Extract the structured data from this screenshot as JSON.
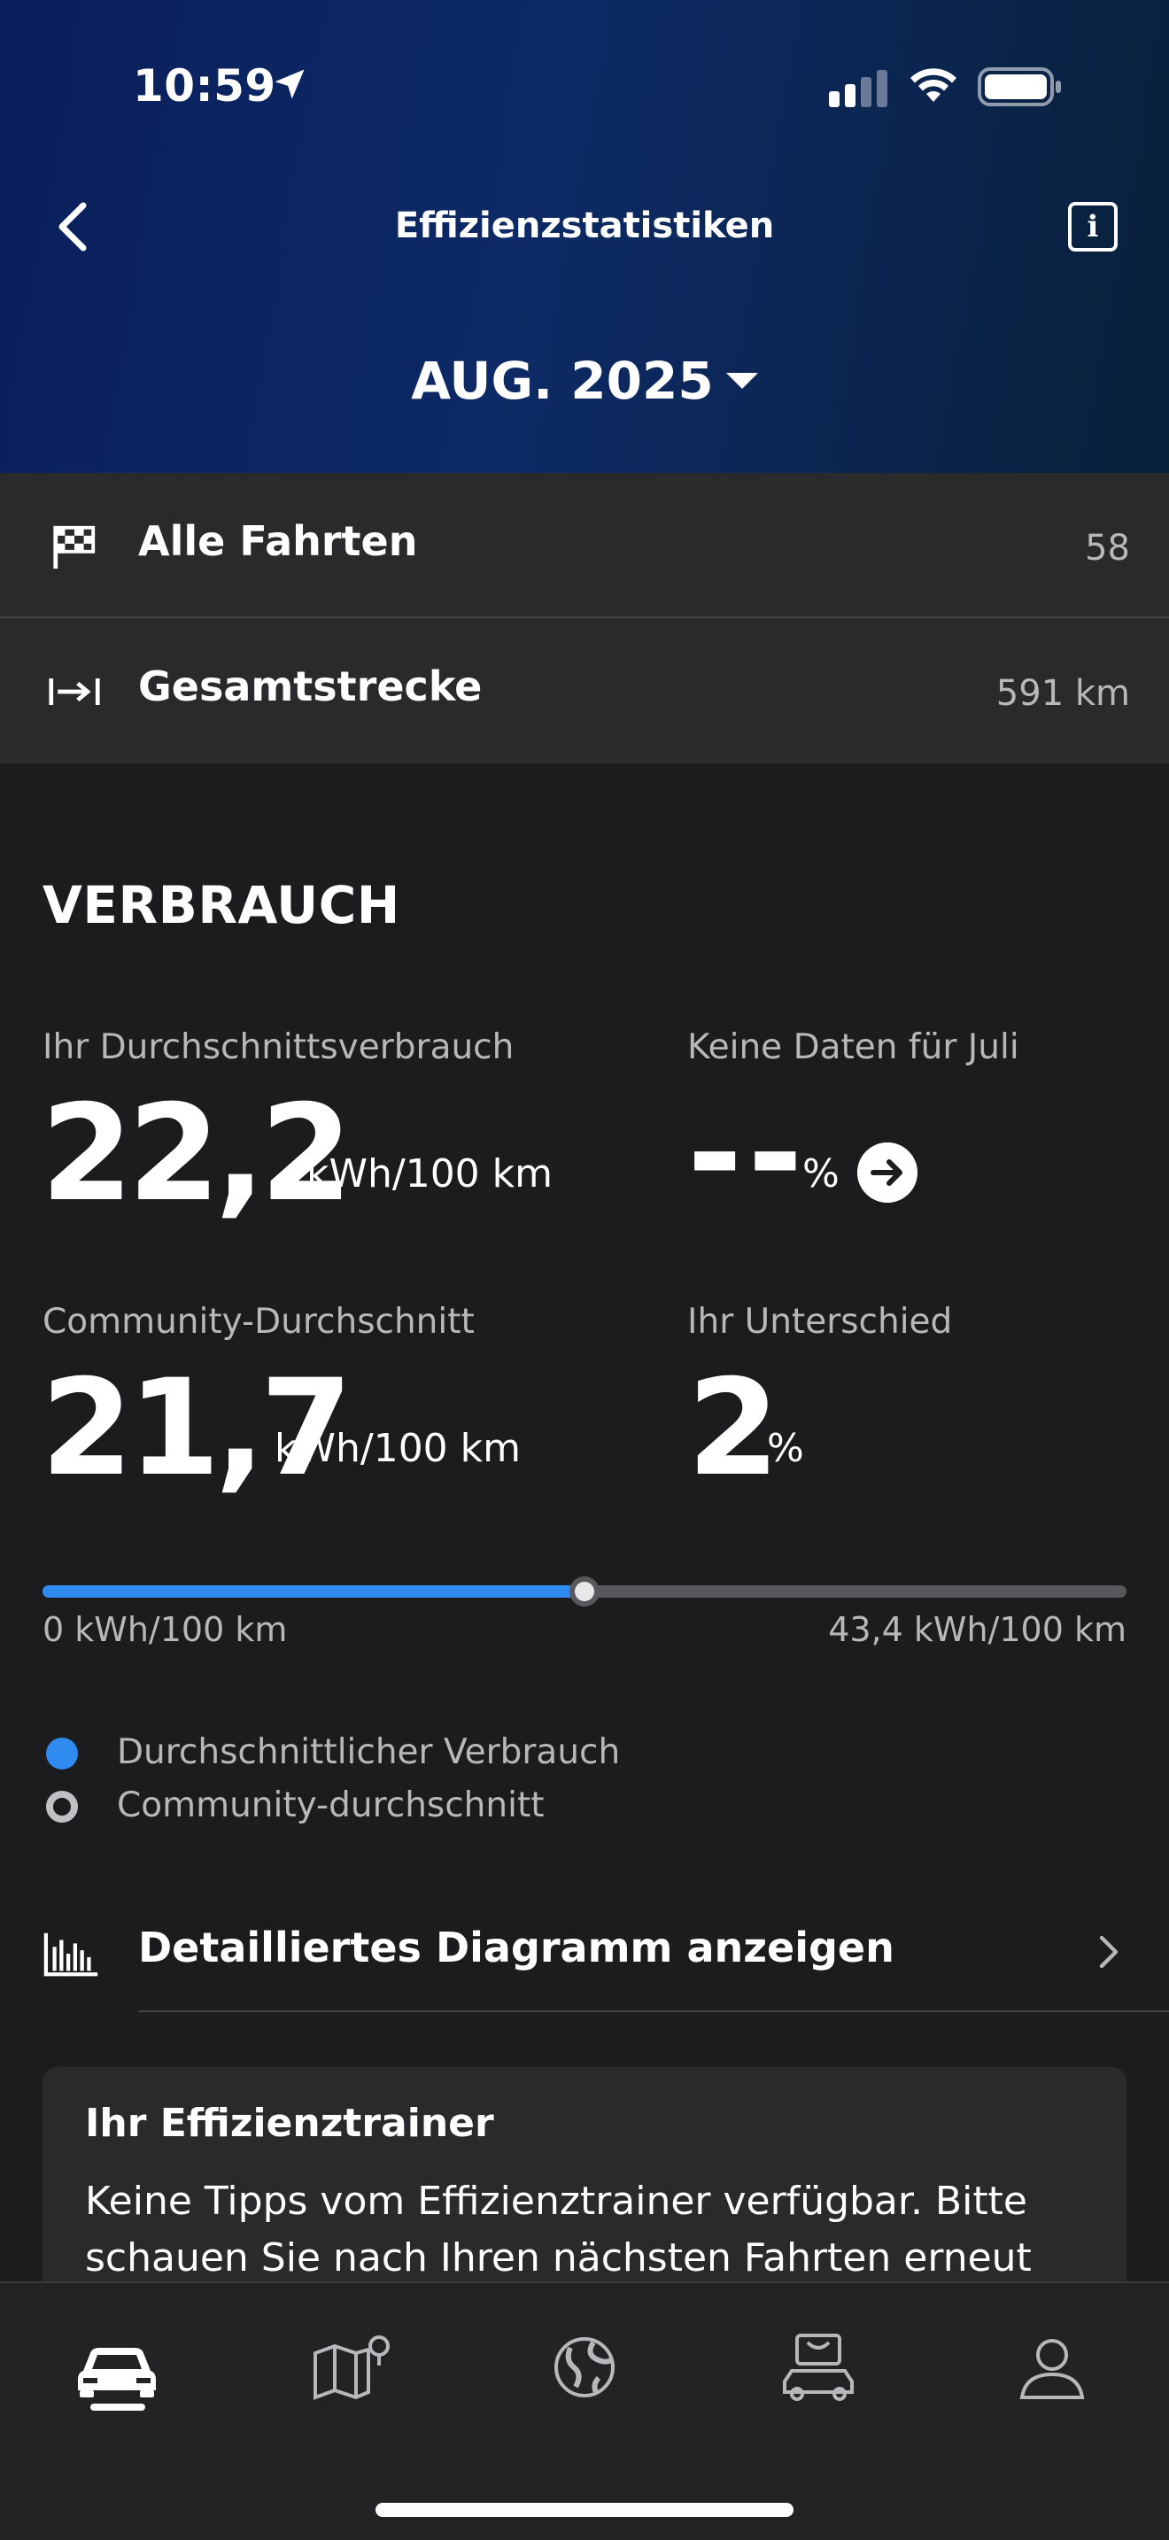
{
  "status_bar": {
    "time": "10:59"
  },
  "header": {
    "title": "Effizienzstatistiken",
    "month": "AUG. 2025",
    "icons": {
      "back": "chevron-left-icon",
      "info": "info-icon"
    }
  },
  "summary": {
    "rows": [
      {
        "label": "Alle Fahrten",
        "value": "58",
        "icon": "checkered-flag-icon"
      },
      {
        "label": "Gesamtstrecke",
        "value": "591 km",
        "icon": "distance-arrow-icon"
      }
    ]
  },
  "consumption": {
    "section_title": "VERBRAUCH",
    "average": {
      "label": "Ihr Durchschnittsverbrauch",
      "value": "22,2",
      "unit": "kWh/100 km"
    },
    "previous": {
      "label": "Keine Daten für Juli",
      "value": "--",
      "unit": "%"
    },
    "community": {
      "label": "Community-Durchschnitt",
      "value": "21,7",
      "unit": "kWh/100 km"
    },
    "difference": {
      "label": "Ihr Unterschied",
      "value": "2",
      "unit": "%"
    },
    "scale": {
      "min_label": "0 kWh/100 km",
      "max_label": "43,4 kWh/100 km",
      "min": 0,
      "max": 43.4,
      "user_value": 22.2,
      "community_value": 21.7
    },
    "legend": [
      {
        "label": "Durchschnittlicher Verbrauch",
        "color": "#2f8bf0"
      },
      {
        "label": "Community-durchschnitt",
        "color": "#c0c0c4"
      }
    ],
    "diagram_link": "Detailliertes Diagramm anzeigen"
  },
  "trainer": {
    "title": "Ihr Effizienztrainer",
    "text": "Keine Tipps vom Effizienztrainer verfügbar. Bitte schauen Sie nach Ihren nächsten Fahrten erneut"
  },
  "tabbar": {
    "tabs": [
      {
        "icon": "car-icon",
        "active": true
      },
      {
        "icon": "map-icon",
        "active": false
      },
      {
        "icon": "globe-icon",
        "active": false
      },
      {
        "icon": "shop-car-icon",
        "active": false
      },
      {
        "icon": "profile-icon",
        "active": false
      }
    ]
  },
  "colors": {
    "accent": "#2f8bf0",
    "background": "#1c1c1e",
    "header": "#0d2a66"
  }
}
